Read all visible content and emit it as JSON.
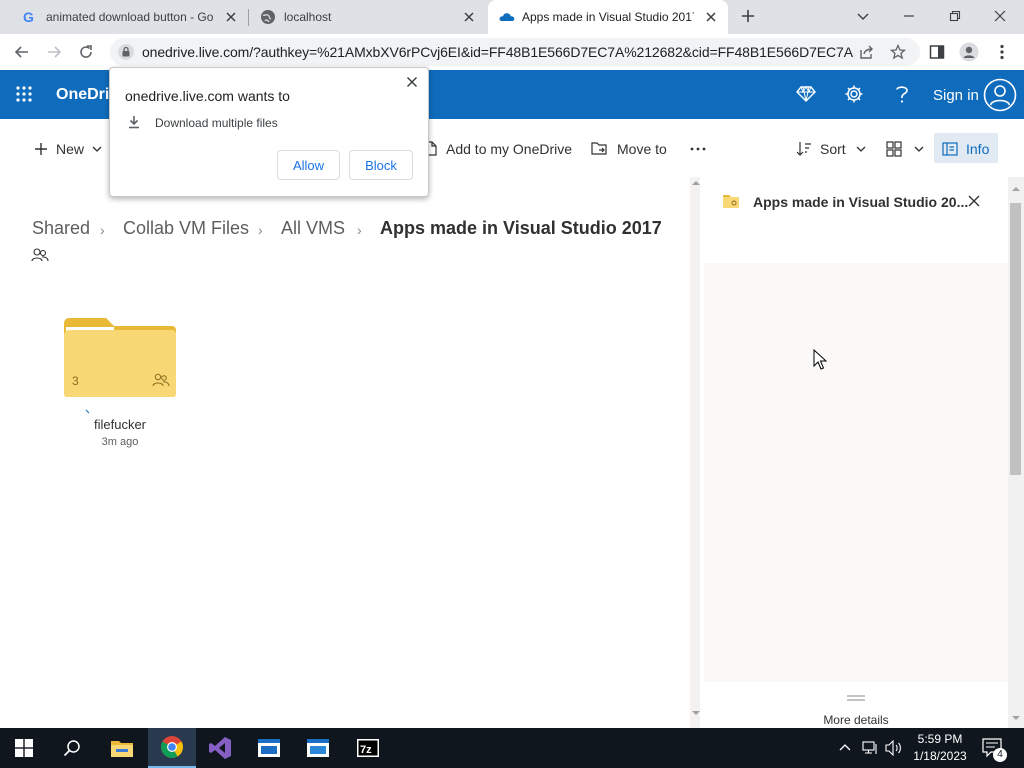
{
  "browser": {
    "tabs": [
      {
        "title": "animated download button - Go",
        "favicon": "google-icon"
      },
      {
        "title": "localhost",
        "favicon": "globe-icon"
      },
      {
        "title": "Apps made in Visual Studio 2017",
        "favicon": "onedrive-cloud-icon",
        "active": true
      }
    ],
    "url": "onedrive.live.com/?authkey=%21AMxbXV6rPCvj6EI&id=FF48B1E566D7EC7A%212682&cid=FF48B1E566D7EC7A"
  },
  "permission_popup": {
    "title": "onedrive.live.com wants to",
    "request": "Download multiple files",
    "allow_label": "Allow",
    "block_label": "Block"
  },
  "header": {
    "app_name": "OneDrive",
    "sign_in_label": "Sign in"
  },
  "command_bar": {
    "new_label": "New",
    "add_label": "Add to my OneDrive",
    "move_label": "Move to",
    "sort_label": "Sort",
    "info_label": "Info"
  },
  "breadcrumb": {
    "items": [
      "Shared",
      "Collab VM Files",
      "All VMS"
    ],
    "current": "Apps made in Visual Studio 2017"
  },
  "folder": {
    "name": "filefucker",
    "modified": "3m ago",
    "item_count": "3"
  },
  "info_pane": {
    "title": "Apps made in Visual Studio 20...",
    "more_details_label": "More details"
  },
  "taskbar": {
    "time": "5:59 PM",
    "date": "1/18/2023",
    "notification_count": "4"
  },
  "colors": {
    "brand": "#0f6cbd",
    "folder": "#f8d775",
    "taskbar": "#10161e"
  }
}
